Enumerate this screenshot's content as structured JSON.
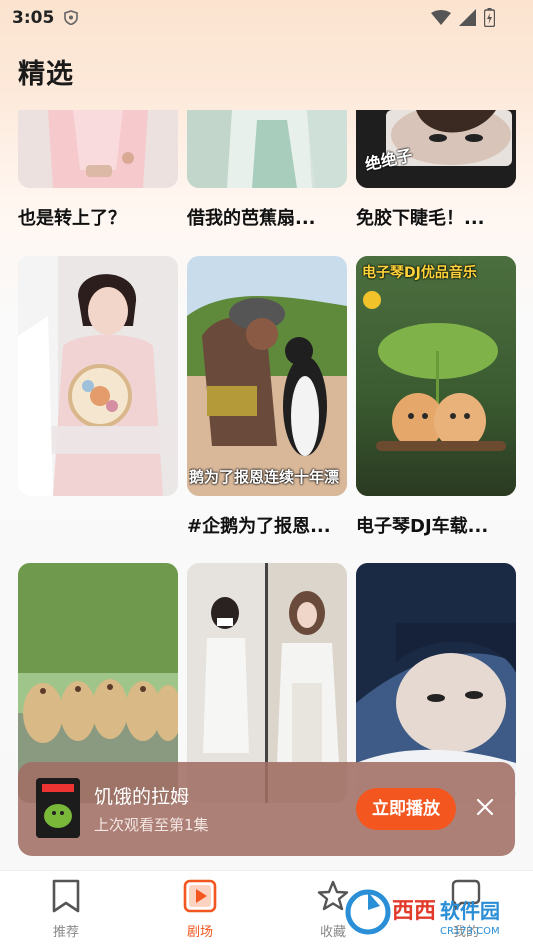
{
  "status_bar": {
    "time": "3:05"
  },
  "header": {
    "title": "精选"
  },
  "cards": [
    {
      "title": "也是转上了？",
      "caption": ""
    },
    {
      "title": "借我的芭蕉扇...",
      "caption": ""
    },
    {
      "title": "免胶下睫毛！...",
      "caption": "绝绝子"
    },
    {
      "title": "",
      "caption": ""
    },
    {
      "title": "#企鹅为了报恩...",
      "caption": "鹅为了报恩连续十年漂"
    },
    {
      "title": "电子琴DJ车载...",
      "caption": "电子琴DJ优品音乐"
    },
    {
      "title": "",
      "caption": ""
    },
    {
      "title": "",
      "caption": ""
    },
    {
      "title": "",
      "caption": ""
    }
  ],
  "mini_player": {
    "title": "饥饿的拉姆",
    "subtitle": "上次观看至第1集",
    "play_label": "立即播放"
  },
  "nav": [
    {
      "label": "推荐",
      "icon": "bookmark-icon"
    },
    {
      "label": "剧场",
      "icon": "play-square-icon"
    },
    {
      "label": "收藏",
      "icon": "star-icon"
    },
    {
      "label": "我的",
      "icon": "chat-icon"
    }
  ],
  "watermark": {
    "text": "西西软件园",
    "sub": "CR173.COM"
  },
  "colors": {
    "accent": "#f4561f",
    "player_bg": "#a06e64"
  }
}
